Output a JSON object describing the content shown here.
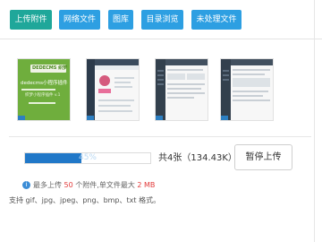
{
  "tabs": [
    {
      "label": "上传附件",
      "active": true
    },
    {
      "label": "网络文件",
      "active": false
    },
    {
      "label": "图库",
      "active": false
    },
    {
      "label": "目录浏览",
      "active": false
    },
    {
      "label": "未处理文件",
      "active": false
    }
  ],
  "thumb1": {
    "brand": "DEDECMS 织梦",
    "title": "dedecms小程序插件",
    "subtitle": "织梦小程序插件 v.1"
  },
  "progress": {
    "percent_text": "45%",
    "value": 0.45
  },
  "upload": {
    "count_text": "共4张（134.43K）",
    "pause_label": "暂停上传"
  },
  "limits": {
    "prefix": "最多上传 ",
    "max_files": "50",
    "middle": " 个附件,单文件最大 ",
    "max_size": "2 MB",
    "support": "支持 gif、jpg、jpeg、png、bmp、txt 格式。"
  },
  "colors": {
    "primary": "#2d9fe2",
    "active_tab": "#1fa79a",
    "progress": "#2178c8",
    "alert": "#e23b3b"
  },
  "icons": {
    "info": "info-icon"
  }
}
